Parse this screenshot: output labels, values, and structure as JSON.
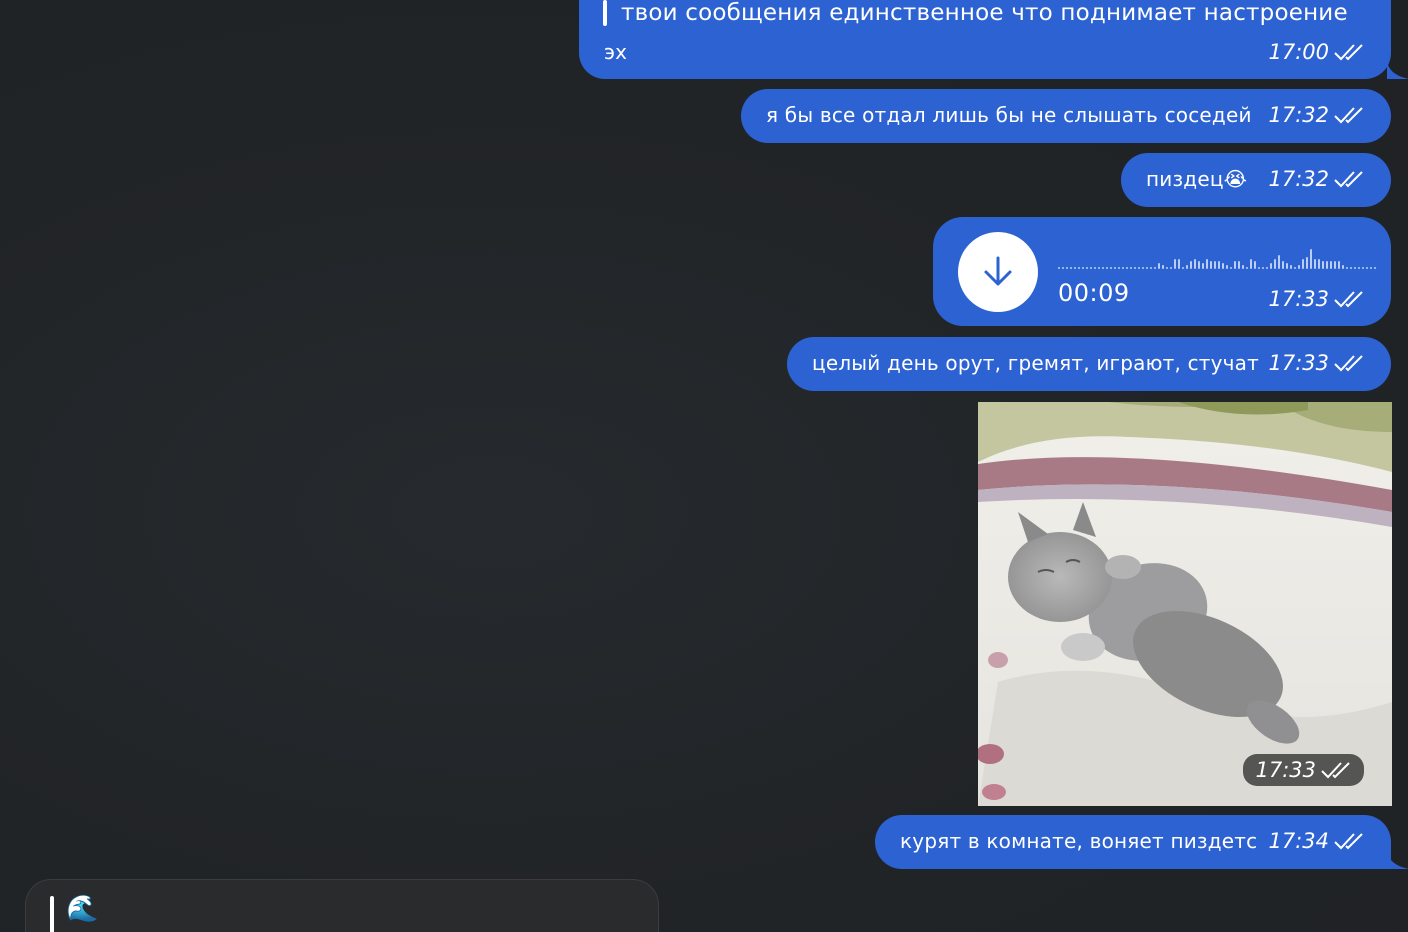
{
  "messages": [
    {
      "id": "m1",
      "reply_quote": "твои сообщения единственное что поднимает настроение",
      "text": "эх",
      "time": "17:00"
    },
    {
      "id": "m2",
      "text": "я бы все отдал лишь бы не слышать соседей",
      "time": "17:32"
    },
    {
      "id": "m3",
      "text": "пиздец😭",
      "time": "17:32"
    },
    {
      "id": "m4",
      "type": "voice",
      "duration": "00:09",
      "time": "17:33",
      "download_icon": "arrow-down-icon"
    },
    {
      "id": "m5",
      "text": "целый день орут, гремят, играют, стучат",
      "time": "17:33"
    },
    {
      "id": "m6",
      "type": "photo",
      "time": "17:33"
    },
    {
      "id": "m7",
      "text": "курят в комнате, воняет пиздетс",
      "time": "17:34"
    }
  ],
  "composer": {
    "reply_preview": "🌊"
  },
  "colors": {
    "background": "#222427",
    "bubble_outgoing": "#2d62d2",
    "text": "#ffffff"
  }
}
